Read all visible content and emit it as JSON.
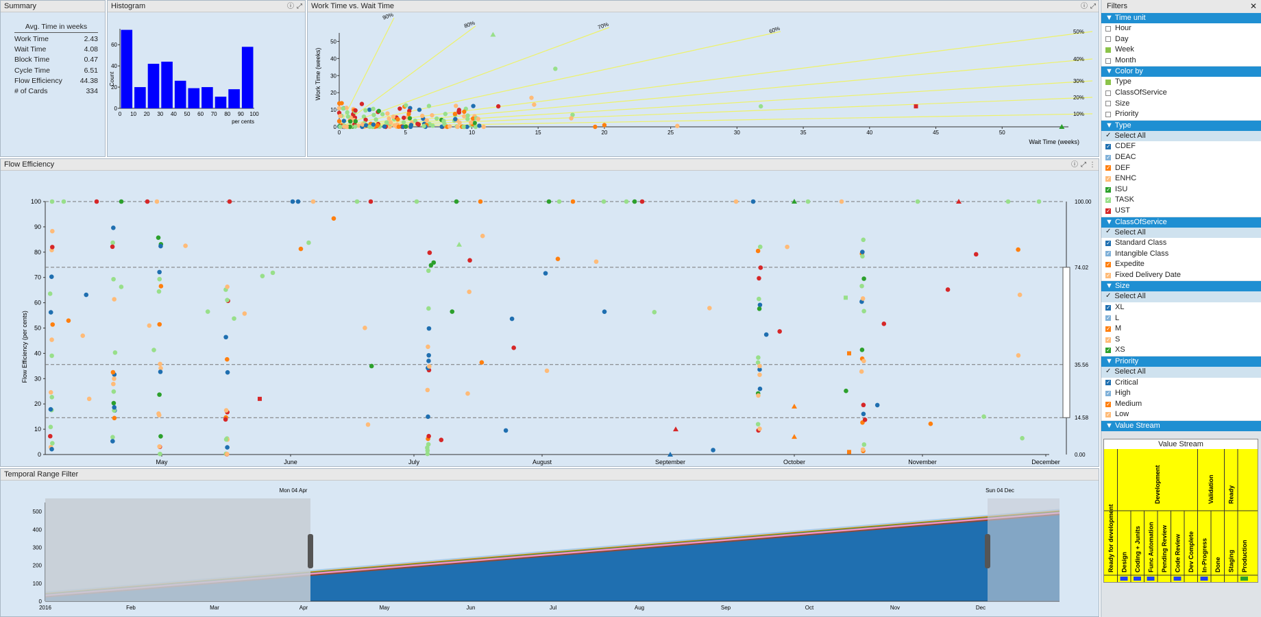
{
  "summary": {
    "title": "Summary",
    "header": "Avg. Time in weeks",
    "rows": [
      {
        "label": "Work Time",
        "value": "2.43"
      },
      {
        "label": "Wait Time",
        "value": "4.08"
      },
      {
        "label": "Block Time",
        "value": "0.47"
      },
      {
        "label": "Cycle Time",
        "value": "6.51"
      },
      {
        "label": "Flow Efficiency",
        "value": "44.38"
      },
      {
        "label": "# of Cards",
        "value": "334"
      }
    ]
  },
  "histogram": {
    "title": "Histogram",
    "ylabel": "Count",
    "xlabel": "per cents",
    "yticks": [
      "0",
      "20",
      "40",
      "60"
    ],
    "xticks": [
      "0",
      "10",
      "20",
      "30",
      "40",
      "50",
      "60",
      "70",
      "80",
      "90",
      "100"
    ],
    "bar_color": "#0000ff"
  },
  "worktime": {
    "title": "Work Time vs. Wait Time",
    "ylabel": "Work Time (weeks)",
    "xlabel": "Wait Time (weeks)",
    "yticks": [
      "0",
      "10",
      "20",
      "30",
      "40",
      "50"
    ],
    "xticks": [
      "0",
      "5",
      "10",
      "15",
      "20",
      "25",
      "30",
      "35",
      "40",
      "45",
      "50"
    ],
    "ray_labels": [
      "90%",
      "80%",
      "70%",
      "60%",
      "50%",
      "40%",
      "30%",
      "20%",
      "10%"
    ]
  },
  "flow": {
    "title": "Flow Efficiency",
    "ylabel": "Flow Efficiency (per cents)",
    "xlabel": "Time",
    "yticks": [
      "0",
      "10",
      "20",
      "30",
      "40",
      "50",
      "60",
      "70",
      "80",
      "90",
      "100"
    ],
    "months": [
      "May",
      "June",
      "July",
      "August",
      "September",
      "October",
      "November",
      "December"
    ],
    "right_labels": [
      "100.00",
      "74.02",
      "35.56",
      "14.58",
      "0.00"
    ]
  },
  "temporal": {
    "title": "Temporal Range Filter",
    "yticks": [
      "0",
      "100",
      "200",
      "300",
      "400",
      "500"
    ],
    "months": [
      "2016",
      "Feb",
      "Mar",
      "Apr",
      "May",
      "Jun",
      "Jul",
      "Aug",
      "Sep",
      "Oct",
      "Nov",
      "Dec"
    ],
    "start_label": "Mon 04 Apr",
    "end_label": "Sun 04 Dec"
  },
  "filters": {
    "title": "Filters",
    "sections": [
      {
        "name": "Time unit",
        "items": [
          {
            "label": "Hour",
            "checked": false
          },
          {
            "label": "Day",
            "checked": false
          },
          {
            "label": "Week",
            "checked": true
          },
          {
            "label": "Month",
            "checked": false
          }
        ]
      },
      {
        "name": "Color by",
        "items": [
          {
            "label": "Type",
            "checked": true
          },
          {
            "label": "ClassOfService",
            "checked": false
          },
          {
            "label": "Size",
            "checked": false
          },
          {
            "label": "Priority",
            "checked": false
          }
        ]
      },
      {
        "name": "Type",
        "items": [
          {
            "label": "Select All",
            "checked": true,
            "all": true
          },
          {
            "label": "CDEF",
            "checked": true,
            "color": "#1f6fb0"
          },
          {
            "label": "DEAC",
            "checked": true,
            "color": "#7fb0d8"
          },
          {
            "label": "DEF",
            "checked": true,
            "color": "#ff7f0e"
          },
          {
            "label": "ENHC",
            "checked": true,
            "color": "#ffbb78"
          },
          {
            "label": "ISU",
            "checked": true,
            "color": "#2ca02c"
          },
          {
            "label": "TASK",
            "checked": true,
            "color": "#98df8a"
          },
          {
            "label": "UST",
            "checked": true,
            "color": "#d62728"
          }
        ]
      },
      {
        "name": "ClassOfService",
        "items": [
          {
            "label": "Select All",
            "checked": true,
            "all": true
          },
          {
            "label": "Standard Class",
            "checked": true,
            "color": "#1f6fb0"
          },
          {
            "label": "Intangible Class",
            "checked": true,
            "color": "#7fb0d8"
          },
          {
            "label": "Expedite",
            "checked": true,
            "color": "#ff7f0e"
          },
          {
            "label": "Fixed Delivery Date",
            "checked": true,
            "color": "#ffbb78"
          }
        ]
      },
      {
        "name": "Size",
        "items": [
          {
            "label": "Select All",
            "checked": true,
            "all": true
          },
          {
            "label": "XL",
            "checked": true,
            "color": "#1f6fb0"
          },
          {
            "label": "L",
            "checked": true,
            "color": "#7fb0d8"
          },
          {
            "label": "M",
            "checked": true,
            "color": "#ff7f0e"
          },
          {
            "label": "S",
            "checked": true,
            "color": "#ffbb78"
          },
          {
            "label": "XS",
            "checked": true,
            "color": "#2ca02c"
          }
        ]
      },
      {
        "name": "Priority",
        "items": [
          {
            "label": "Select All",
            "checked": true,
            "all": true
          },
          {
            "label": "Critical",
            "checked": true,
            "color": "#1f6fb0"
          },
          {
            "label": "High",
            "checked": true,
            "color": "#7fb0d8"
          },
          {
            "label": "Medium",
            "checked": true,
            "color": "#ff7f0e"
          },
          {
            "label": "Low",
            "checked": true,
            "color": "#ffbb78"
          }
        ]
      },
      {
        "name": "Value Stream",
        "items": []
      }
    ],
    "value_stream": {
      "title": "Value Stream",
      "groups": [
        "Ready for development",
        "Development",
        "Validation",
        "Ready"
      ],
      "columns": [
        "Design",
        "Coding + Junits",
        "Func Automation",
        "Pending Review",
        "Code Review",
        "Dev Complete",
        "In-Progress",
        "Done",
        "Staging",
        "Production"
      ]
    }
  }
}
